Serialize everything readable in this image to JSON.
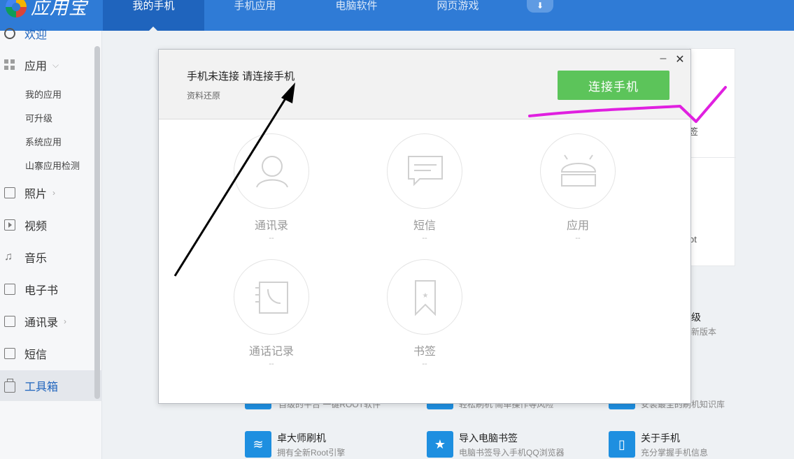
{
  "app": {
    "name": "应用宝"
  },
  "nav": {
    "tabs": [
      "我的手机",
      "手机应用",
      "电脑软件",
      "网页游戏"
    ]
  },
  "sidebar": {
    "items": [
      {
        "label": "欢迎",
        "icon": "globe-icon"
      },
      {
        "label": "应用",
        "icon": "grid-icon"
      },
      {
        "label": "照片",
        "icon": "photo-icon"
      },
      {
        "label": "视频",
        "icon": "video-icon"
      },
      {
        "label": "音乐",
        "icon": "music-icon"
      },
      {
        "label": "电子书",
        "icon": "book-icon"
      },
      {
        "label": "通讯录",
        "icon": "contacts-icon"
      },
      {
        "label": "短信",
        "icon": "message-icon"
      },
      {
        "label": "工具箱",
        "icon": "toolbox-icon"
      }
    ],
    "sub_items": [
      "我的应用",
      "可升级",
      "系统应用",
      "山寨应用检测"
    ]
  },
  "dialog": {
    "title": "手机未连接 请连接手机",
    "subtitle": "资料还原",
    "connect_label": "连接手机",
    "features": [
      {
        "label": "通讯录",
        "value": "--",
        "icon": "person-icon"
      },
      {
        "label": "短信",
        "value": "--",
        "icon": "message-bubble-icon"
      },
      {
        "label": "应用",
        "value": "--",
        "icon": "android-icon"
      },
      {
        "label": "通话记录",
        "value": "--",
        "icon": "call-log-icon"
      },
      {
        "label": "书签",
        "value": "--",
        "icon": "bookmark-icon"
      }
    ]
  },
  "background": {
    "fragments": [
      "签",
      "ot",
      "级",
      "新版本"
    ],
    "partial_descs": [
      "自级的平台 一键ROOT软件",
      "轻松刷机 简单操作等风险",
      "安装最全的刷机知识库"
    ],
    "tools": [
      {
        "title": "卓大师刷机",
        "desc": "拥有全新Root引擎"
      },
      {
        "title": "导入电脑书签",
        "desc": "电脑书签导入手机QQ浏览器"
      },
      {
        "title": "关于手机",
        "desc": "充分掌握手机信息"
      }
    ]
  },
  "annotation_colors": {
    "arrow": "#000000",
    "underline": "#e020e0"
  }
}
